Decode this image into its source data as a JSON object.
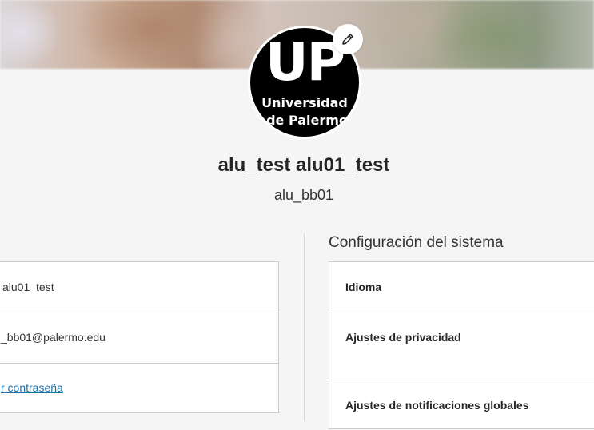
{
  "profile": {
    "full_name": "alu_test alu01_test",
    "username": "alu_bb01",
    "avatar_logo": {
      "line_big": "UP",
      "line_1": "Universidad",
      "line_2": "de Palermo"
    },
    "edit_icon": "pencil-icon"
  },
  "basic_info": {
    "rows": [
      {
        "value": "alu01_test"
      },
      {
        "value": "_bb01@palermo.edu"
      },
      {
        "value": "r contraseña"
      }
    ]
  },
  "system_settings": {
    "title": "Configuración del sistema",
    "items": [
      {
        "label": "Idioma"
      },
      {
        "label": "Ajustes de privacidad"
      },
      {
        "label": "Ajustes de notificaciones globales"
      }
    ]
  },
  "colors": {
    "link": "#1a6fa8",
    "page_background": "#f5f5f5",
    "card_border": "#cdcdcd"
  }
}
